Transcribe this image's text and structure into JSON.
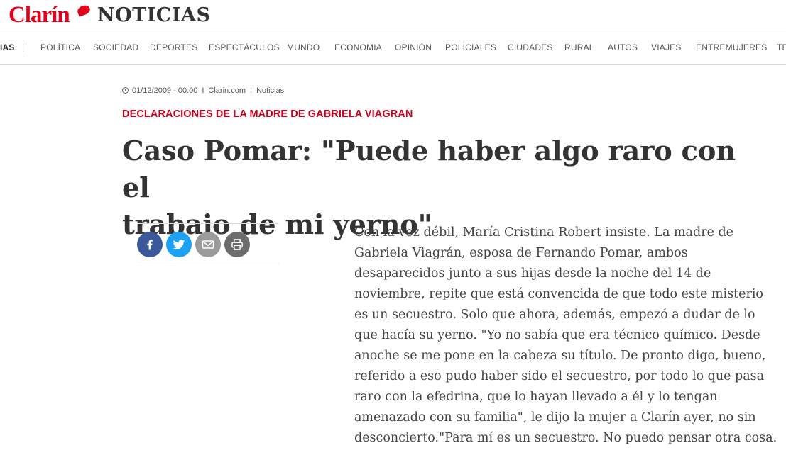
{
  "header": {
    "logo_text": "Clarín",
    "section_title": "NOTICIAS",
    "brand_color": "#e2001a"
  },
  "nav": {
    "items": [
      "IAS",
      "POLÍTICA",
      "SOCIEDAD",
      "DEPORTES",
      "ESPECTÁCULOS",
      "MUNDO",
      "ECONOMIA",
      "OPINIÓN",
      "POLICIALES",
      "CIUDADES",
      "RURAL",
      "AUTOS",
      "VIAJES",
      "ENTREMUJERES",
      "TE"
    ],
    "separator": "|"
  },
  "article": {
    "date": "01/12/2009 - 00:00",
    "source": "Clarin.com",
    "section": "Noticias",
    "meta_separator": "I",
    "kicker": "DECLARACIONES DE LA MADRE DE GABRIELA VIAGRAN",
    "kicker_color": "#c9001c",
    "headline_line1": "Caso Pomar: \"Puede haber algo raro con el",
    "headline_line2": "trabajo de mi yerno\"",
    "body": "Con la voz débil, María Cristina Robert insiste. La madre de Gabriela Viagrán, esposa de Fernando Pomar, ambos desaparecidos junto a sus hijas desde la noche del 14 de noviembre, repite que está convencida de que todo este misterio es un secuestro. Solo que ahora, además, empezó a dudar de lo que hacía su yerno. \"Yo no sabía que era técnico químico. Desde anoche se me pone en la cabeza su título. De pronto digo, bueno, referido a eso pudo haber sido el secuestro, por todo lo que pasa raro con la efedrina, que lo hayan llevado a él y lo tengan amenazado con su familia\", le dijo la mujer a Clarín ayer, no sin desconcierto.\"Para mí es un secuestro. No puedo pensar otra cosa."
  },
  "share": {
    "icons": [
      "facebook-icon",
      "twitter-icon",
      "email-icon",
      "print-icon"
    ],
    "colors": {
      "facebook": "#3b5998",
      "twitter": "#1da1f2",
      "email": "#9b9b9b",
      "print": "#6d6d6d"
    }
  }
}
